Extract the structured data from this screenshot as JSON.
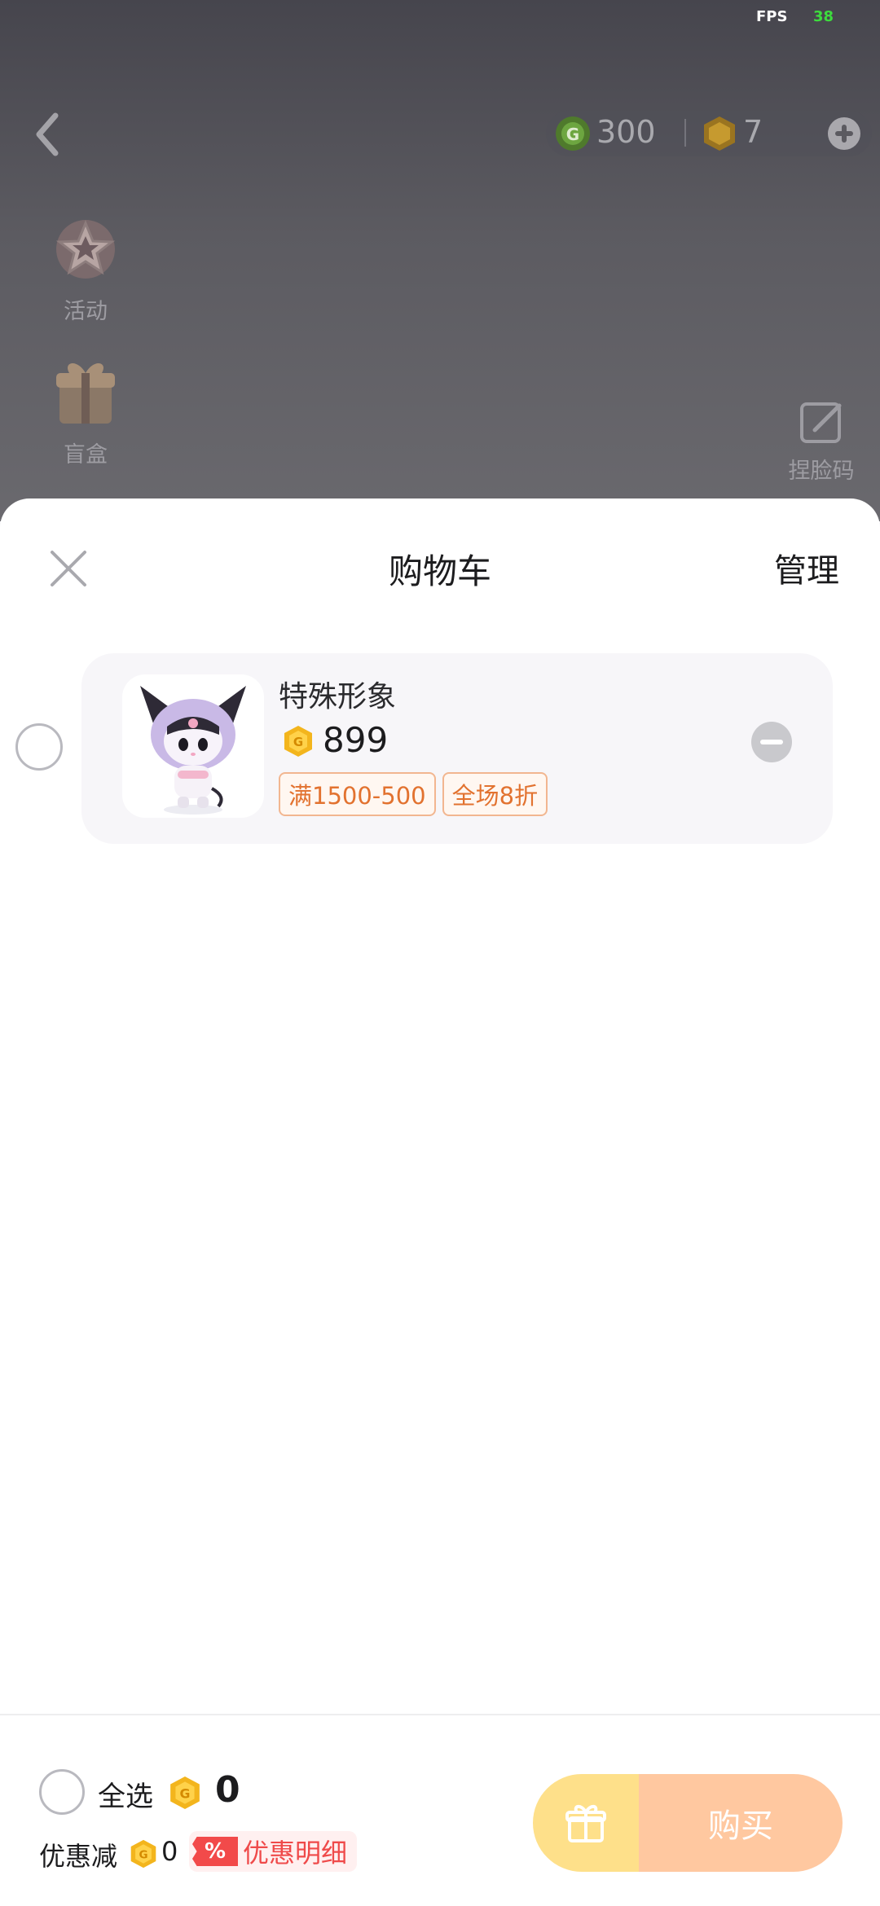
{
  "status": {
    "fps_label": "FPS",
    "fps_value": "38"
  },
  "topbar": {
    "coin_green_value": "300",
    "coin_gold_value": "7",
    "icons": {
      "back": "back-chevron-icon",
      "coin_green": "green-coin-icon",
      "coin_gold": "gold-hex-coin-icon",
      "add": "plus-circle-icon"
    }
  },
  "sidebar": {
    "items": [
      {
        "label": "活动",
        "icon": "star-event-icon"
      },
      {
        "label": "盲盒",
        "icon": "gift-box-icon"
      }
    ]
  },
  "face_code": {
    "label": "捏脸码",
    "icon": "edit-note-icon"
  },
  "cart": {
    "title": "购物车",
    "manage_label": "管理",
    "items": [
      {
        "name": "特殊形象",
        "price": "899",
        "tags": [
          "满1500-500",
          "全场8折"
        ]
      }
    ]
  },
  "footer": {
    "select_all_label": "全选",
    "total": "0",
    "discount_label": "优惠减",
    "discount_value": "0",
    "pct_badge": "%",
    "discount_detail_label": "优惠明细",
    "buy_label": "购买"
  },
  "colors": {
    "accent_orange": "#e2722f",
    "gift_button": "#fee08a",
    "buy_button": "#ffc8a0",
    "discount_red": "#ef4a4a"
  }
}
